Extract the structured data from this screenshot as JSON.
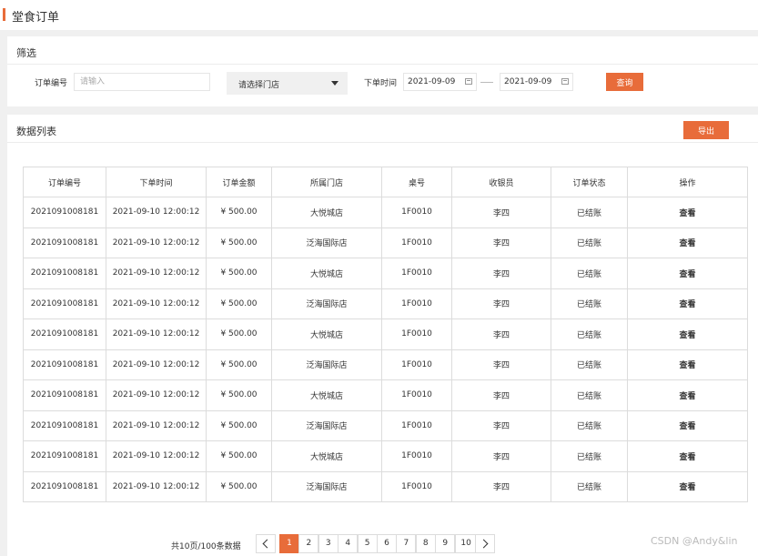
{
  "page": {
    "title": "堂食订单"
  },
  "filter": {
    "section_label": "筛选",
    "order_no_label": "订单编号",
    "order_no_placeholder": "请输入",
    "store_placeholder": "请选择门店",
    "time_label": "下单时间",
    "date_start": "2021-09-09",
    "date_end": "2021-09-09",
    "query_button": "查询"
  },
  "list": {
    "section_label": "数据列表",
    "export_button": "导出",
    "columns": [
      "订单编号",
      "下单时间",
      "订单金额",
      "所属门店",
      "桌号",
      "收银员",
      "订单状态",
      "操作"
    ],
    "rows": [
      [
        "2021091008181",
        "2021-09-10 12:00:12",
        "¥ 500.00",
        "大悦城店",
        "1F0010",
        "李四",
        "已结账",
        "查看"
      ],
      [
        "2021091008181",
        "2021-09-10 12:00:12",
        "¥ 500.00",
        "泛海国际店",
        "1F0010",
        "李四",
        "已结账",
        "查看"
      ],
      [
        "2021091008181",
        "2021-09-10 12:00:12",
        "¥ 500.00",
        "大悦城店",
        "1F0010",
        "李四",
        "已结账",
        "查看"
      ],
      [
        "2021091008181",
        "2021-09-10 12:00:12",
        "¥ 500.00",
        "泛海国际店",
        "1F0010",
        "李四",
        "已结账",
        "查看"
      ],
      [
        "2021091008181",
        "2021-09-10 12:00:12",
        "¥ 500.00",
        "大悦城店",
        "1F0010",
        "李四",
        "已结账",
        "查看"
      ],
      [
        "2021091008181",
        "2021-09-10 12:00:12",
        "¥ 500.00",
        "泛海国际店",
        "1F0010",
        "李四",
        "已结账",
        "查看"
      ],
      [
        "2021091008181",
        "2021-09-10 12:00:12",
        "¥ 500.00",
        "大悦城店",
        "1F0010",
        "李四",
        "已结账",
        "查看"
      ],
      [
        "2021091008181",
        "2021-09-10 12:00:12",
        "¥ 500.00",
        "泛海国际店",
        "1F0010",
        "李四",
        "已结账",
        "查看"
      ],
      [
        "2021091008181",
        "2021-09-10 12:00:12",
        "¥ 500.00",
        "大悦城店",
        "1F0010",
        "李四",
        "已结账",
        "查看"
      ],
      [
        "2021091008181",
        "2021-09-10 12:00:12",
        "¥ 500.00",
        "泛海国际店",
        "1F0010",
        "李四",
        "已结账",
        "查看"
      ]
    ]
  },
  "pagination": {
    "info": "共10页/100条数据",
    "pages": [
      "1",
      "2",
      "3",
      "4",
      "5",
      "6",
      "7",
      "8",
      "9",
      "10"
    ],
    "current": "1"
  },
  "watermark": "CSDN @Andy&lin",
  "colors": {
    "accent": "#e86c3a"
  },
  "icons": {
    "calendar": "calendar-icon",
    "dropdown": "caret-down-icon",
    "prev": "chevron-left-icon",
    "next": "chevron-right-icon"
  }
}
